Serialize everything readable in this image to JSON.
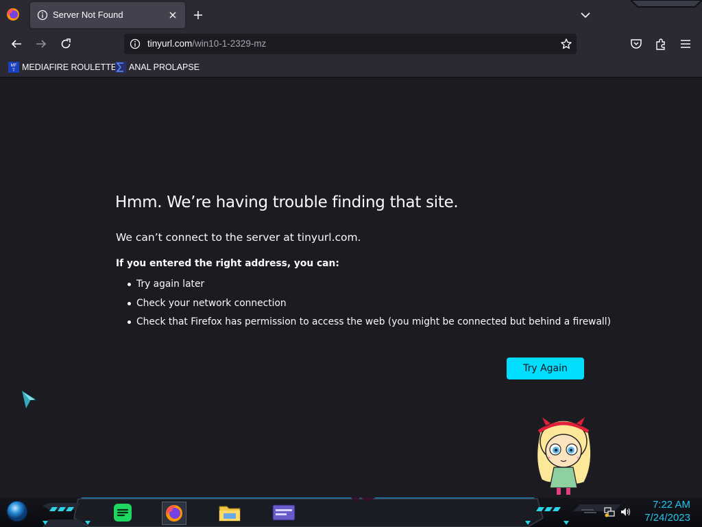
{
  "browser": {
    "tab": {
      "title": "Server Not Found"
    },
    "url": {
      "host": "tinyurl.com",
      "path": "/win10-1-2329-mz"
    },
    "bookmarks": [
      {
        "label": "MEDIAFIRE ROULETTER",
        "icon": "mediafire-icon"
      },
      {
        "label": "ANAL PROLAPSE",
        "icon": "sigma-icon"
      }
    ]
  },
  "error_page": {
    "title": "Hmm. We’re having trouble finding that site.",
    "short_desc": "We can’t connect to the server at tinyurl.com.",
    "hint": "If you entered the right address, you can:",
    "suggestions": [
      "Try again later",
      "Check your network connection",
      "Check that Firefox has permission to access the web (you might be connected but behind a firewall)"
    ],
    "try_again_label": "Try Again"
  },
  "taskbar": {
    "apps": [
      "start-orb-icon",
      "spotify-icon",
      "firefox-icon",
      "file-explorer-icon",
      "window-app-icon"
    ],
    "tray": [
      "network-icon",
      "volume-icon"
    ],
    "clock": {
      "time": "7:22 AM",
      "date": "7/24/2023"
    }
  },
  "colors": {
    "accent": "#00ddff",
    "page_bg": "#1c1b22",
    "toolbar_bg": "#2b2a33",
    "clock": "#24c6ee"
  }
}
